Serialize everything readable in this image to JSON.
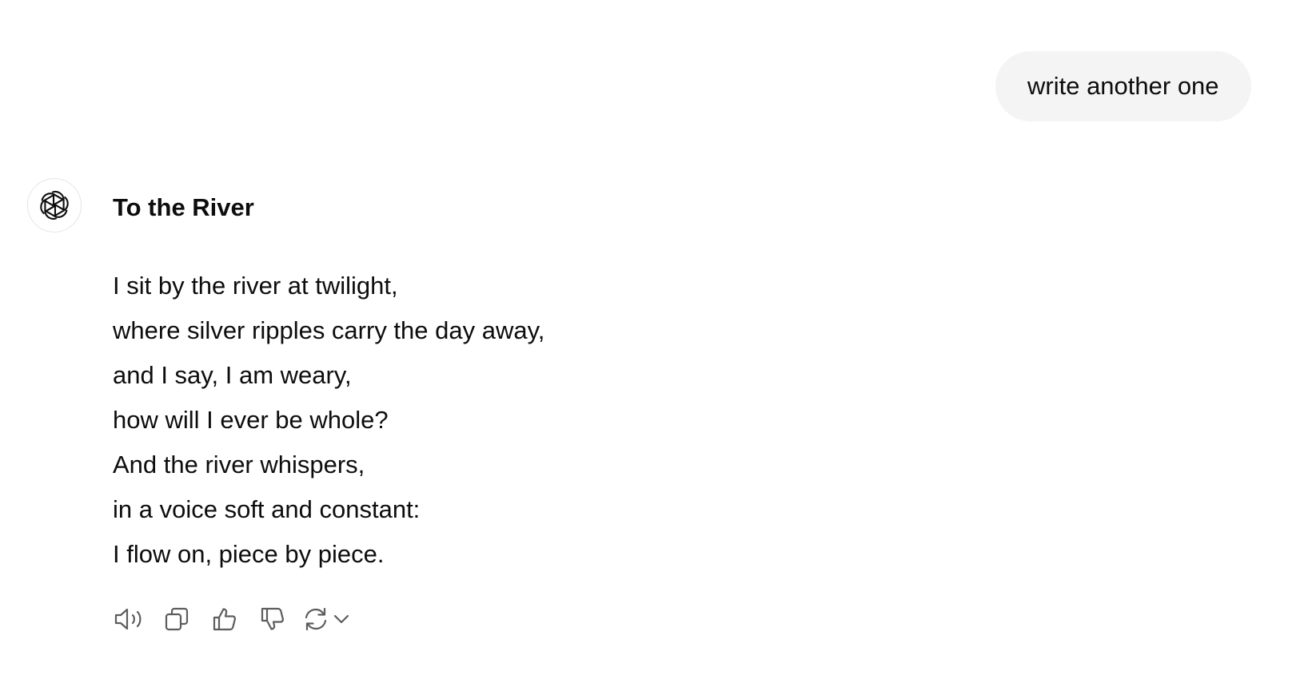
{
  "user_message": {
    "text": "write another one"
  },
  "assistant": {
    "avatar_icon": "openai-logo-icon",
    "title": "To the River",
    "poem_lines": [
      "I sit by the river at twilight,",
      "where silver ripples carry the day away,",
      "and I say, I am weary,",
      "how will I ever be whole?",
      "And the river whispers,",
      "in a voice soft and constant:",
      "I flow on, piece by piece."
    ]
  },
  "actions": {
    "icons": [
      "speaker-icon",
      "copy-icon",
      "thumbs-up-icon",
      "thumbs-down-icon",
      "regenerate-icon",
      "chevron-down-icon"
    ]
  },
  "colors": {
    "text": "#0d0d0d",
    "bubble": "#f4f4f4",
    "icon": "#5d5d5d"
  }
}
